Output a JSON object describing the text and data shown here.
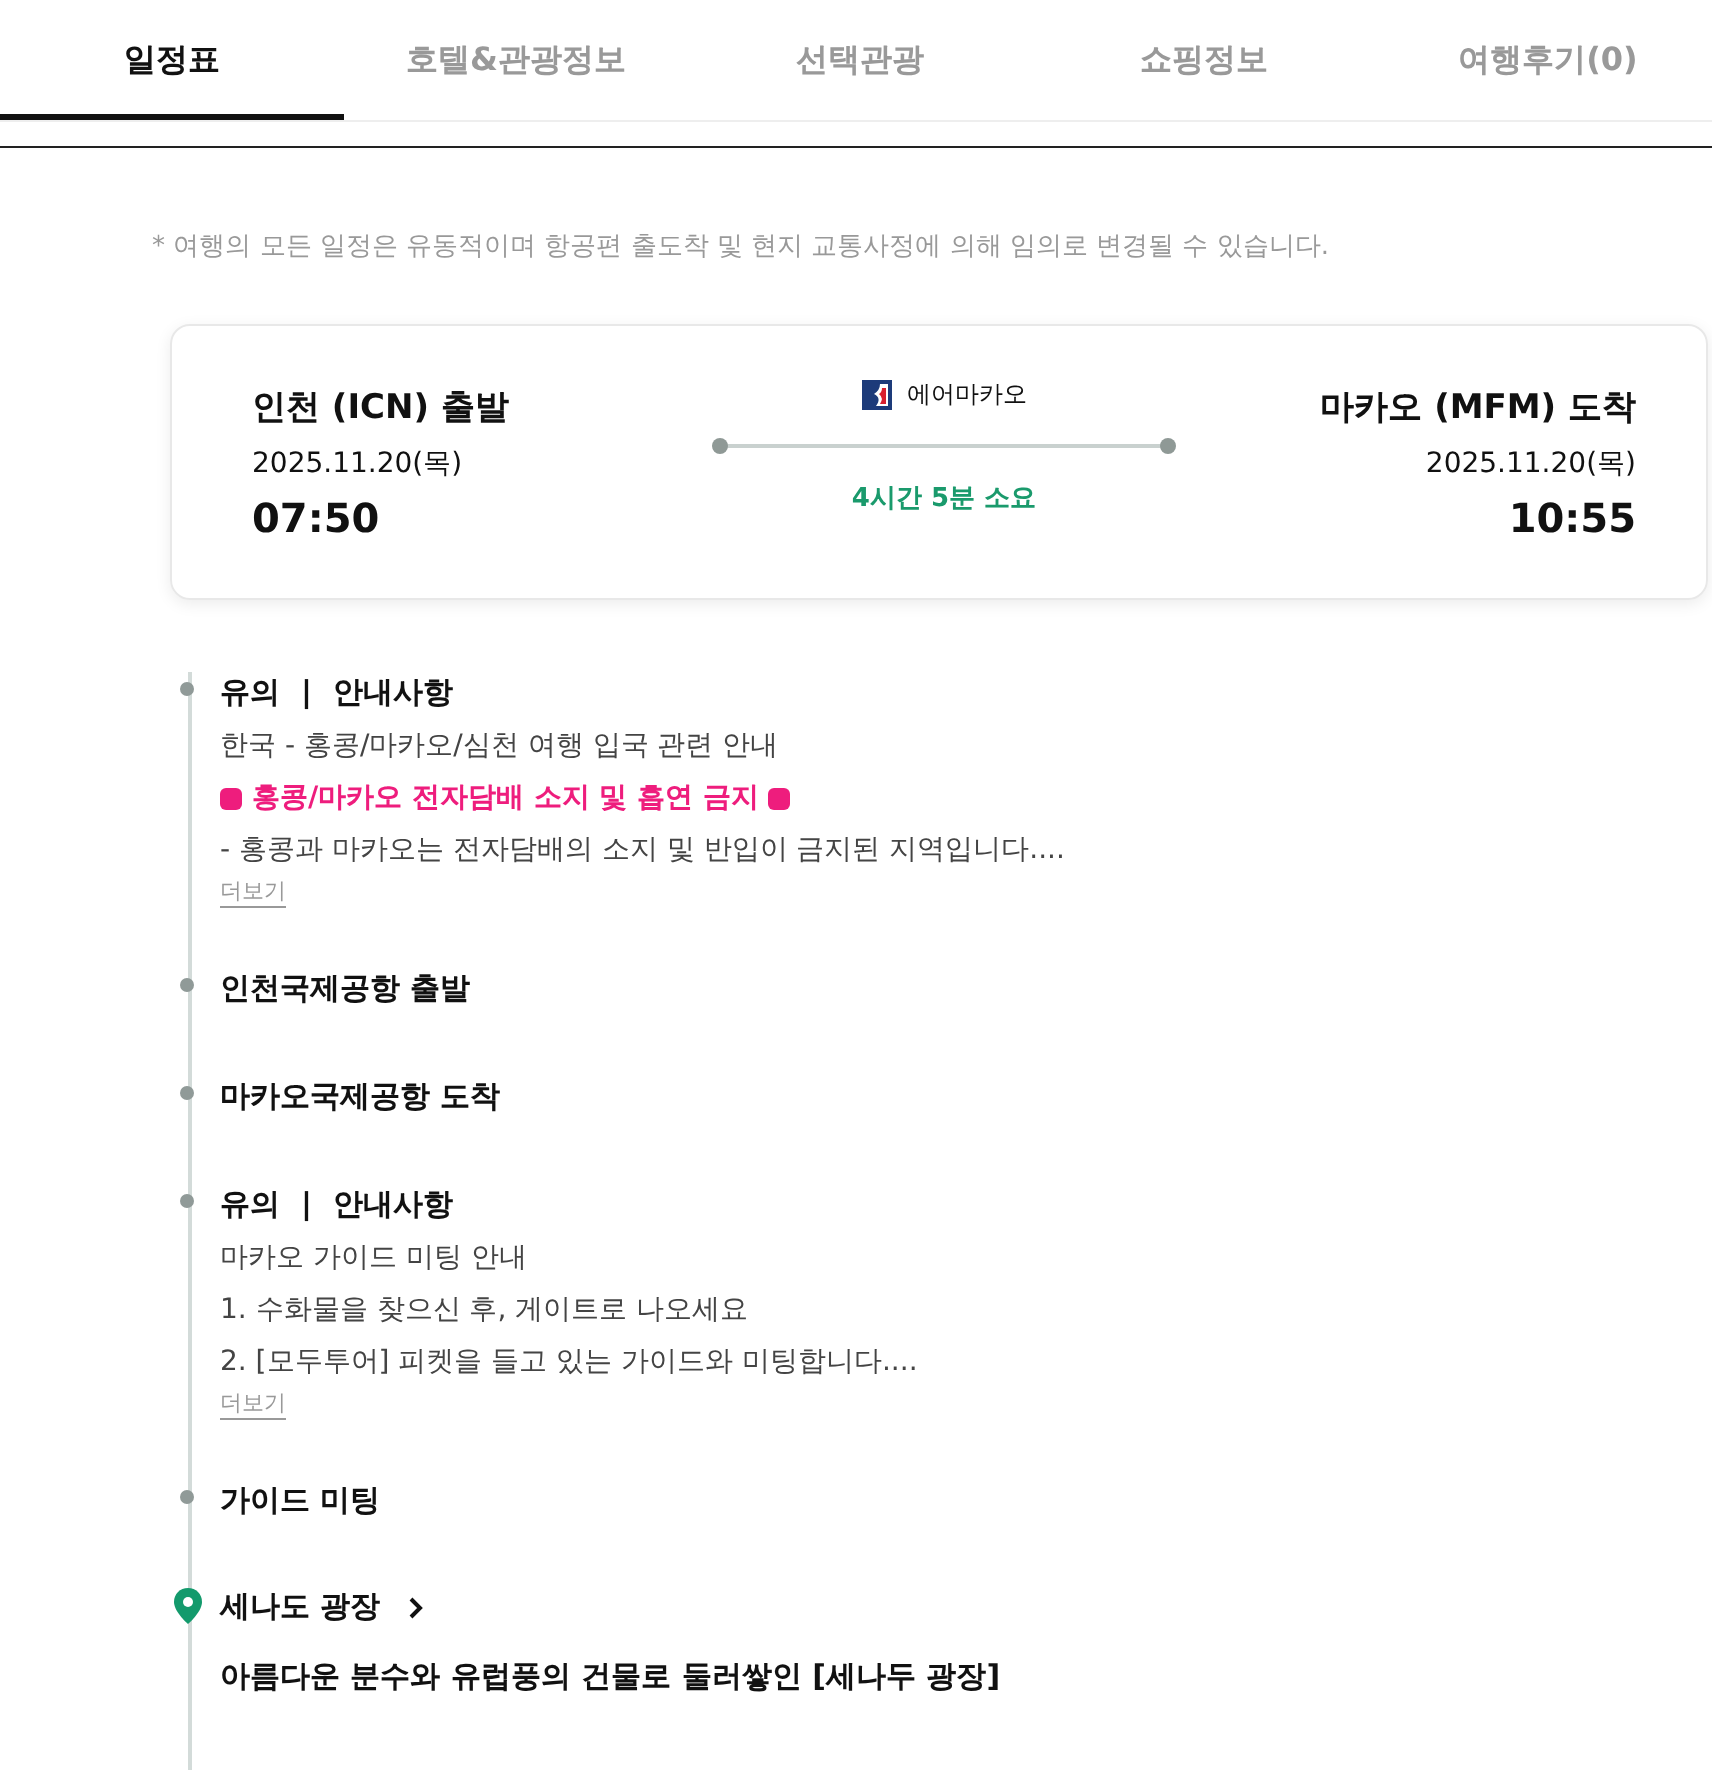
{
  "tabs": [
    {
      "label": "일정표",
      "selected": true
    },
    {
      "label": "호텔&관광정보",
      "selected": false
    },
    {
      "label": "선택관광",
      "selected": false
    },
    {
      "label": "쇼핑정보",
      "selected": false
    },
    {
      "label": "여행후기(0)",
      "selected": false
    }
  ],
  "notice": "* 여행의 모든 일정은 유동적이며 항공편 출도착 및 현지 교통사정에 의해 임의로 변경될 수 있습니다.",
  "flight": {
    "departure": {
      "place": "인천 (ICN) 출발",
      "date": "2025.11.20(목)",
      "time": "07:50"
    },
    "airline": "에어마카오",
    "duration": "4시간 5분 소요",
    "arrival": {
      "place": "마카오 (MFM) 도착",
      "date": "2025.11.20(목)",
      "time": "10:55"
    }
  },
  "schedule": [
    {
      "kind": "notice",
      "title": "유의  |  안내사항",
      "lines": [
        {
          "kind": "plain",
          "text": "한국 - 홍콩/마카오/심천 여행 입국 관련 안내"
        },
        {
          "kind": "highlight",
          "text": "홍콩/마카오 전자담배 소지 및 흡연 금지"
        },
        {
          "kind": "plain",
          "text": "- 홍콩과 마카오는 전자담배의 소지 및 반입이 금지된 지역입니다...."
        }
      ],
      "more": "더보기"
    },
    {
      "kind": "stop",
      "title": "인천국제공항 출발"
    },
    {
      "kind": "stop",
      "title": "마카오국제공항 도착"
    },
    {
      "kind": "notice",
      "title": "유의  |  안내사항",
      "lines": [
        {
          "kind": "plain",
          "text": "마카오 가이드 미팅 안내"
        },
        {
          "kind": "plain",
          "text": "1. 수화물을 찾으신 후, 게이트로 나오세요"
        },
        {
          "kind": "plain",
          "text": "2. [모두투어] 피켓을 들고 있는 가이드와 미팅합니다...."
        }
      ],
      "more": "더보기"
    },
    {
      "kind": "stop",
      "title": "가이드 미팅"
    },
    {
      "kind": "place",
      "title": "세나도 광장",
      "description": "아름다운 분수와 유럽풍의 건물로 둘러쌓인 [세나두 광장]"
    }
  ]
}
